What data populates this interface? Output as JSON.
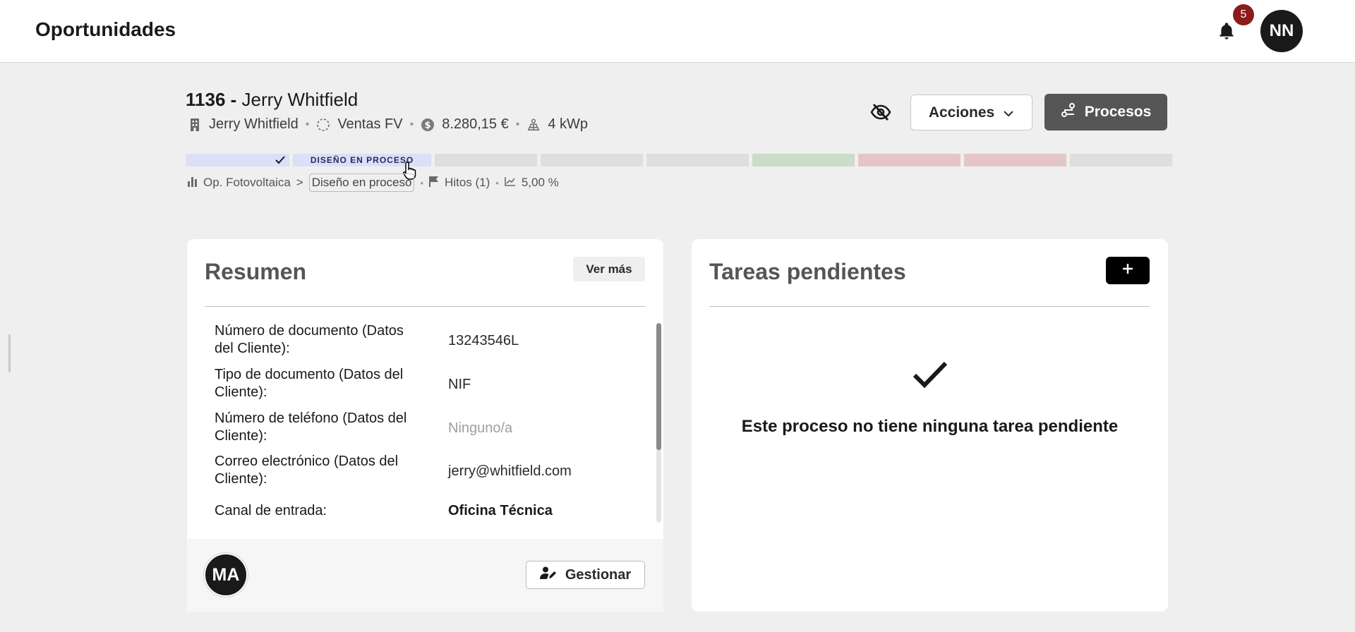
{
  "header": {
    "title": "Oportunidades",
    "notification_count": "5",
    "user_initials": "NN"
  },
  "opportunity": {
    "number": "1136",
    "separator": "-",
    "name": "Jerry Whitfield",
    "meta": {
      "company": "Jerry Whitfield",
      "pipeline": "Ventas FV",
      "amount": "8.280,15 €",
      "power": "4 kWp"
    },
    "actions_label": "Acciones",
    "processes_label": "Procesos"
  },
  "stages": [
    {
      "status": "done",
      "color": "#dcdff7"
    },
    {
      "label": "DISEÑO EN PROCESO",
      "status": "current",
      "color": "#dcdff7"
    },
    {
      "status": "pending",
      "color": "#dedede"
    },
    {
      "status": "pending",
      "color": "#dedede"
    },
    {
      "status": "pending",
      "color": "#dedede"
    },
    {
      "status": "won",
      "color": "#cbddc8"
    },
    {
      "status": "lost",
      "color": "#e4c6c6"
    },
    {
      "status": "lost",
      "color": "#e4c6c6"
    },
    {
      "status": "pending",
      "color": "#dedede"
    }
  ],
  "breadcrumb": {
    "pipeline": "Op. Fotovoltaica",
    "chevron": ">",
    "stage": "Diseño en proceso",
    "milestones": "Hitos (1)",
    "probability": "5,00 %"
  },
  "summary": {
    "title": "Resumen",
    "more_label": "Ver más",
    "rows": [
      {
        "label": "Número de documento (Datos del Cliente):",
        "value": "13243546L"
      },
      {
        "label": "Tipo de documento (Datos del Cliente):",
        "value": "NIF"
      },
      {
        "label": "Número de teléfono (Datos del Cliente):",
        "value": "Ninguno/a"
      },
      {
        "label": "Correo electrónico (Datos del Cliente):",
        "value": "jerry@whitfield.com"
      },
      {
        "label": "Canal de entrada:",
        "value": "Oficina Técnica"
      }
    ],
    "owner_initials": "MA",
    "manage_label": "Gestionar"
  },
  "tasks": {
    "title": "Tareas pendientes",
    "add_label": "+",
    "empty_message": "Este proceso no tiene ninguna tarea pendiente"
  },
  "colors": {
    "accent_dark": "#555555",
    "badge_red": "#8c1b1b"
  }
}
